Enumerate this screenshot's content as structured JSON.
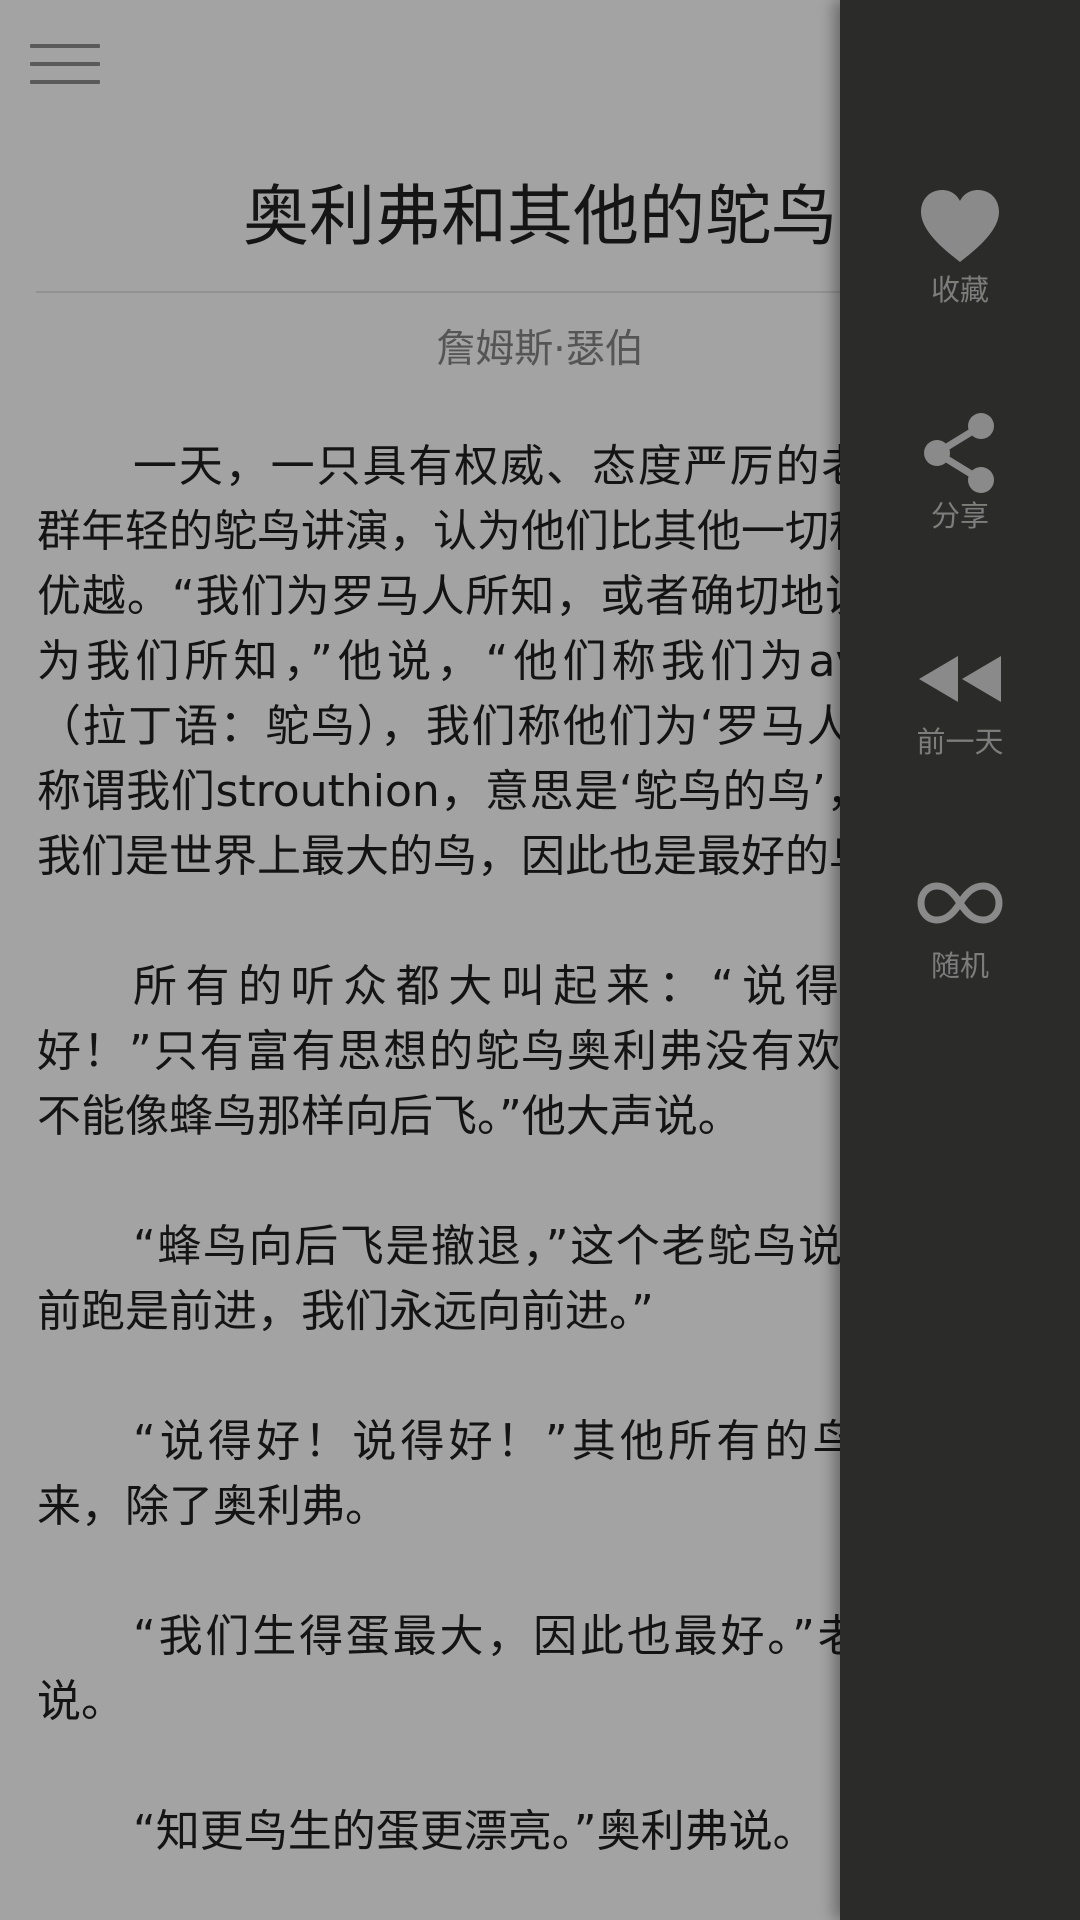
{
  "article": {
    "title": "奥利弗和其他的鸵鸟",
    "author": "詹姆斯·瑟伯",
    "paragraphs": [
      "一天，一只具有权威、态度严厉的老鸵鸟对一群年轻的鸵鸟讲演，认为他们比其他一切种类的鸟都优越。“我们为罗马人所知，或者确切地说，罗马人为我们所知，”他说，“他们称我们为avisstuthio（拉丁语：鸵鸟），我们称他们为‘罗马人’。希腊人称谓我们strouthion，意思是‘鸵鸟的鸟’，好像是。我们是世界上最大的鸟，因此也是最好的鸟。”",
      "所有的听众都大叫起来：“说得好！说得好！”只有富有思想的鸵鸟奥利弗没有欢呼。“我们不能像蜂鸟那样向后飞。”他大声说。",
      "“蜂鸟向后飞是撤退，”这个老鸵鸟说，“我们向前跑是前进，我们永远向前进。”",
      "“说得好！说得好！”其他所有的鸟都欢呼起来，除了奥利弗。",
      "“我们生得蛋最大，因此也最好。”老学究继续说。",
      "“知更鸟生的蛋更漂亮。”奥利弗说。"
    ]
  },
  "sidebar": {
    "items": [
      {
        "label": "收藏",
        "icon": "heart-icon"
      },
      {
        "label": "分享",
        "icon": "share-icon"
      },
      {
        "label": "前一天",
        "icon": "rewind-icon"
      },
      {
        "label": "随机",
        "icon": "infinity-icon"
      }
    ]
  },
  "colors": {
    "overlay_background": "#a3a3a3",
    "sidebar_background": "#2b2b29",
    "sidebar_icon": "#8a8a8a",
    "sidebar_label": "#7d7d7d"
  }
}
